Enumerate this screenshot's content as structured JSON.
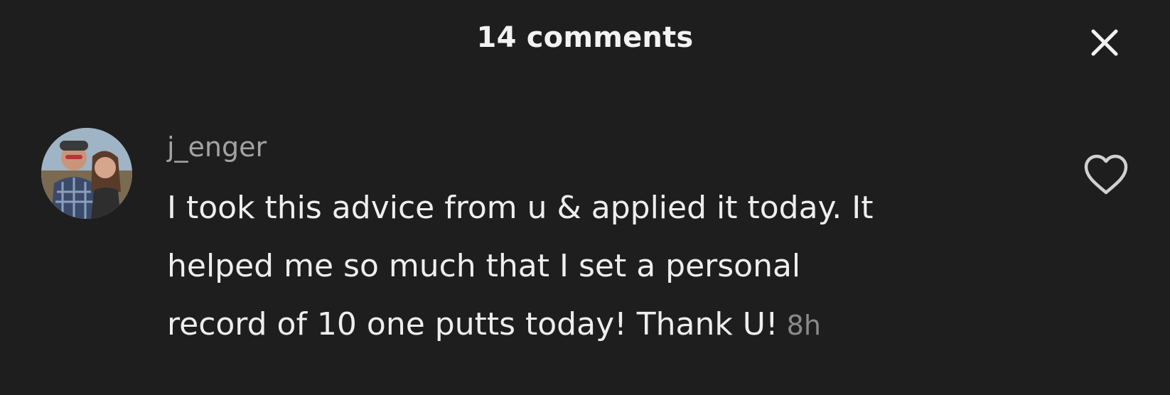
{
  "header": {
    "title": "14 comments",
    "close_icon": "close-icon"
  },
  "comment": {
    "avatar_icon": "user-avatar",
    "username": "j_enger",
    "text_lines": [
      "I took this advice from u & applied it today. It",
      "helped me so much that I set a personal",
      "record of 10 one putts today! Thank U!"
    ],
    "timestamp": "8h",
    "like_icon": "heart-outline-icon"
  },
  "colors": {
    "background": "#1e1e1e",
    "title": "#f2f2f2",
    "username": "#a3a3a3",
    "body_text": "#eeeeee",
    "timestamp": "#8a8a8a",
    "icon": "#d0d0d0"
  }
}
